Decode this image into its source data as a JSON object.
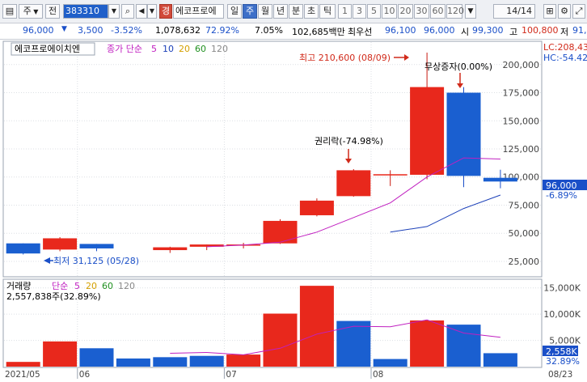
{
  "toolbar": {
    "market_dropdown": "주",
    "prev_label": "전",
    "stock_code": "383310",
    "stock_name": "에코프로에",
    "badge": "경",
    "periods": [
      "일",
      "주",
      "월",
      "년",
      "분",
      "초",
      "틱"
    ],
    "selected_period": "주",
    "intervals": [
      "1",
      "3",
      "5",
      "10",
      "20",
      "30",
      "60",
      "120"
    ],
    "page_indicator": "14/14"
  },
  "infobar": {
    "price": "96,000",
    "change": "3,500",
    "change_pct": "-3.52%",
    "volume": "1,078,632",
    "vol_ratio": "72.92%",
    "turnover": "7.05%",
    "amount": "102,685백만",
    "bid_label": "최우선",
    "bid1": "96,100",
    "bid2": "96,000",
    "open_label": "시",
    "open": "99,300",
    "high_label": "고",
    "high": "100,800",
    "low_label": "저",
    "low": "91,"
  },
  "price_panel": {
    "stock_label": "에코프로에이치엔",
    "ma_label": "종가 단순",
    "ma_periods": [
      "5",
      "10",
      "20",
      "60",
      "120"
    ],
    "ma_colors": [
      "#c020c0",
      "#1a3fb8",
      "#d4a000",
      "#209020",
      "#888888"
    ],
    "lc_label": "LC:208,43",
    "hc_label": "HC:-54.42",
    "current_price_tag": "96,000",
    "current_change_tag": "-6.89%",
    "annotations": {
      "high": "최고 210,600 (08/09)",
      "low": "최저 31,125 (05/28)",
      "rights": "권리락(-74.98%)",
      "bonus": "무상증자(0.00%)"
    }
  },
  "volume_panel": {
    "title": "거래량",
    "ma_label": "단순",
    "ma_periods": [
      "5",
      "20",
      "60",
      "120"
    ],
    "ma_colors": [
      "#c020c0",
      "#d4a000",
      "#209020",
      "#888888"
    ],
    "summary": "2,557,838주(32.89%)",
    "current_tag": "2,558K",
    "current_pct_tag": "32.89%"
  },
  "x_labels": [
    "2021/05",
    "06",
    "07",
    "08",
    "08/23"
  ],
  "chart_data": [
    {
      "type": "candlestick",
      "title": "에코프로에이치엔",
      "y_ticks": [
        25000,
        50000,
        75000,
        100000,
        125000,
        150000,
        175000,
        200000
      ],
      "y_tick_labels": [
        "25,000",
        "50,000",
        "75,000",
        "100,000",
        "125,000",
        "150,000",
        "175,000",
        "200,000"
      ],
      "ylim": [
        12000,
        220000
      ],
      "candles": [
        {
          "open": 41000,
          "high": 41000,
          "low": 31125,
          "close": 32000
        },
        {
          "open": 35500,
          "high": 46500,
          "low": 34000,
          "close": 45500
        },
        {
          "open": 40500,
          "high": 40500,
          "low": 34000,
          "close": 36500
        },
        {
          "open": 35000,
          "high": 38000,
          "low": 32500,
          "close": 37500
        },
        {
          "open": 38000,
          "high": 40000,
          "low": 35000,
          "close": 40000
        },
        {
          "open": 40000,
          "high": 41500,
          "low": 36500,
          "close": 40000
        },
        {
          "open": 41000,
          "high": 62500,
          "low": 40500,
          "close": 61000
        },
        {
          "open": 66000,
          "high": 81000,
          "low": 65000,
          "close": 79000
        },
        {
          "open": 83000,
          "high": 107000,
          "low": 82500,
          "close": 106000
        },
        {
          "open": 101500,
          "high": 106000,
          "low": 92000,
          "close": 102500
        },
        {
          "open": 102000,
          "high": 210600,
          "low": 98000,
          "close": 180000
        },
        {
          "open": 175000,
          "high": 180000,
          "low": 91000,
          "close": 101000
        },
        {
          "open": 99300,
          "high": 106500,
          "low": 90000,
          "close": 96000
        }
      ],
      "ma5": [
        null,
        null,
        null,
        null,
        38000,
        39500,
        42000,
        51000,
        64000,
        77000,
        100000,
        117000,
        116000
      ],
      "ma10": [
        null,
        null,
        null,
        null,
        null,
        null,
        null,
        null,
        null,
        51000,
        56000,
        72000,
        84000
      ]
    },
    {
      "type": "bar",
      "title": "거래량",
      "y_ticks": [
        5000,
        10000,
        15000
      ],
      "y_tick_labels": [
        "5,000K",
        "10,000K",
        "15,000K"
      ],
      "ylim": [
        0,
        16500
      ],
      "values": [
        900,
        4800,
        3500,
        1550,
        1800,
        2050,
        2300,
        10100,
        15400,
        8700,
        1450,
        8800,
        8000,
        2558
      ],
      "ma5": [
        null,
        null,
        null,
        null,
        2550,
        2700,
        2250,
        3500,
        6200,
        7700,
        7600,
        8900,
        6400,
        5600
      ]
    }
  ]
}
